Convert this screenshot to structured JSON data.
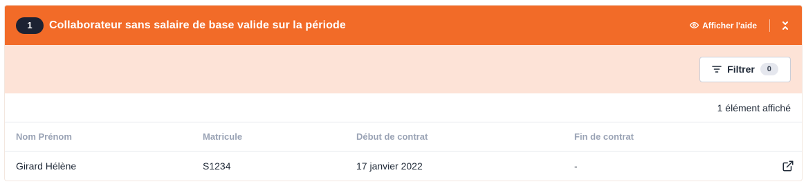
{
  "header": {
    "count": "1",
    "title": "Collaborateur sans salaire de base valide sur la période",
    "help_label": "Afficher l'aide",
    "collapse_icon": "chevron-collapse-icon",
    "background_color": "#f26b28"
  },
  "toolbar": {
    "filter_label": "Filtrer",
    "filter_count": "0",
    "filter_icon": "filter-lines-icon",
    "background_color": "#fde3d7"
  },
  "results": {
    "count_label": "1 élément affiché"
  },
  "table": {
    "columns": [
      "Nom Prénom",
      "Matricule",
      "Début de contrat",
      "Fin de contrat"
    ],
    "rows": [
      {
        "name": "Girard Hélène",
        "matricule": "S1234",
        "start": "17 janvier 2022",
        "end": "-",
        "action_icon": "external-link-icon"
      }
    ]
  }
}
